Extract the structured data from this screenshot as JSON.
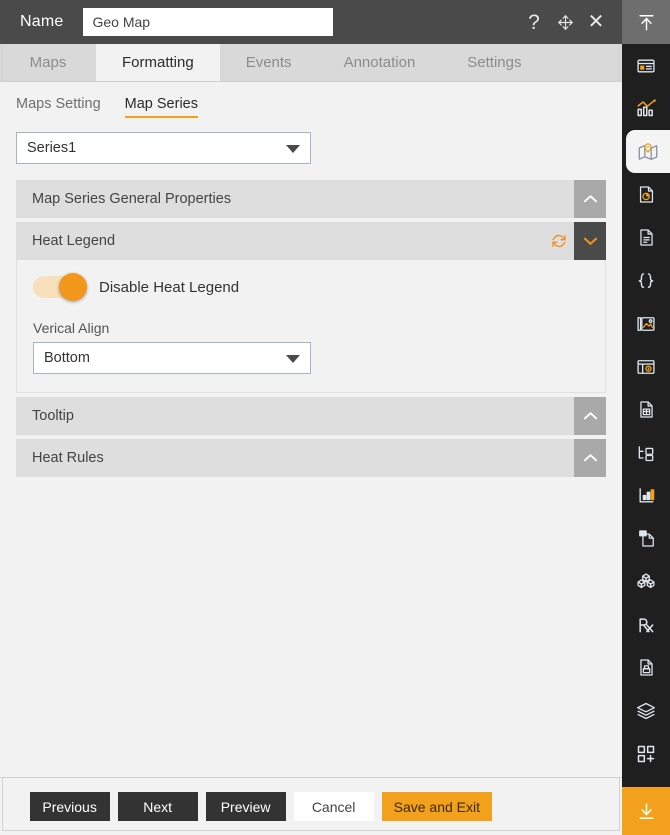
{
  "titlebar": {
    "name_label": "Name",
    "name_value": "Geo Map",
    "name_placeholder": "Geo Map",
    "help_icon": "question-mark-icon",
    "move_icon": "move-arrows-icon",
    "close_icon": "close-icon"
  },
  "tabs": [
    {
      "label": "Maps",
      "active": false
    },
    {
      "label": "Formatting",
      "active": true
    },
    {
      "label": "Events",
      "active": false
    },
    {
      "label": "Annotation",
      "active": false
    },
    {
      "label": "Settings",
      "active": false
    }
  ],
  "subtabs": [
    {
      "label": "Maps Setting",
      "active": false
    },
    {
      "label": "Map Series",
      "active": true
    }
  ],
  "series_select": {
    "value": "Series1",
    "caret_icon": "caret-down-icon"
  },
  "accordions": [
    {
      "title": "Map Series General Properties",
      "expanded": false,
      "chevron_icon": "chevron-up-icon",
      "has_refresh": false
    },
    {
      "title": "Heat Legend",
      "expanded": true,
      "chevron_icon": "chevron-down-icon",
      "has_refresh": true,
      "refresh_icon": "refresh-icon"
    },
    {
      "title": "Tooltip",
      "expanded": false,
      "chevron_icon": "chevron-up-icon",
      "has_refresh": false
    },
    {
      "title": "Heat Rules",
      "expanded": false,
      "chevron_icon": "chevron-up-icon",
      "has_refresh": false
    }
  ],
  "heat_legend_panel": {
    "toggle_label": "Disable Heat Legend",
    "toggle_on": true,
    "align_label": "Verical Align",
    "align_value": "Bottom",
    "caret_icon": "caret-down-icon"
  },
  "footer": {
    "previous": "Previous",
    "next": "Next",
    "preview": "Preview",
    "cancel": "Cancel",
    "save_and_exit": "Save and Exit"
  },
  "sidebar": [
    {
      "icon": "collapse-up-icon",
      "state": "top"
    },
    {
      "icon": "card-layout-icon",
      "state": "normal"
    },
    {
      "icon": "analytics-chart-icon",
      "state": "normal"
    },
    {
      "icon": "map-pin-icon",
      "state": "active"
    },
    {
      "icon": "pie-report-icon",
      "state": "normal"
    },
    {
      "icon": "document-icon",
      "state": "normal"
    },
    {
      "icon": "braces-code-icon",
      "state": "normal"
    },
    {
      "icon": "image-gallery-icon",
      "state": "normal"
    },
    {
      "icon": "dashboard-panel-icon",
      "state": "normal"
    },
    {
      "icon": "grid-document-icon",
      "state": "normal"
    },
    {
      "icon": "tree-structure-icon",
      "state": "normal"
    },
    {
      "icon": "bar-chart-icon",
      "state": "normal"
    },
    {
      "icon": "copy-page-icon",
      "state": "normal"
    },
    {
      "icon": "cubes-icon",
      "state": "normal"
    },
    {
      "icon": "prescription-rx-icon",
      "state": "normal"
    },
    {
      "icon": "save-document-icon",
      "state": "normal"
    },
    {
      "icon": "layers-icon",
      "state": "normal"
    },
    {
      "icon": "add-widget-icon",
      "state": "normal"
    },
    {
      "icon": "download-icon",
      "state": "bottom"
    }
  ],
  "colors": {
    "accent": "#f3a01c",
    "titlebar": "#4a4a4a",
    "panel": "#f2f2f2",
    "tab_inactive": "#d9d9d9",
    "accordion_header": "#dedede",
    "sidebar": "#1f1f1f"
  }
}
